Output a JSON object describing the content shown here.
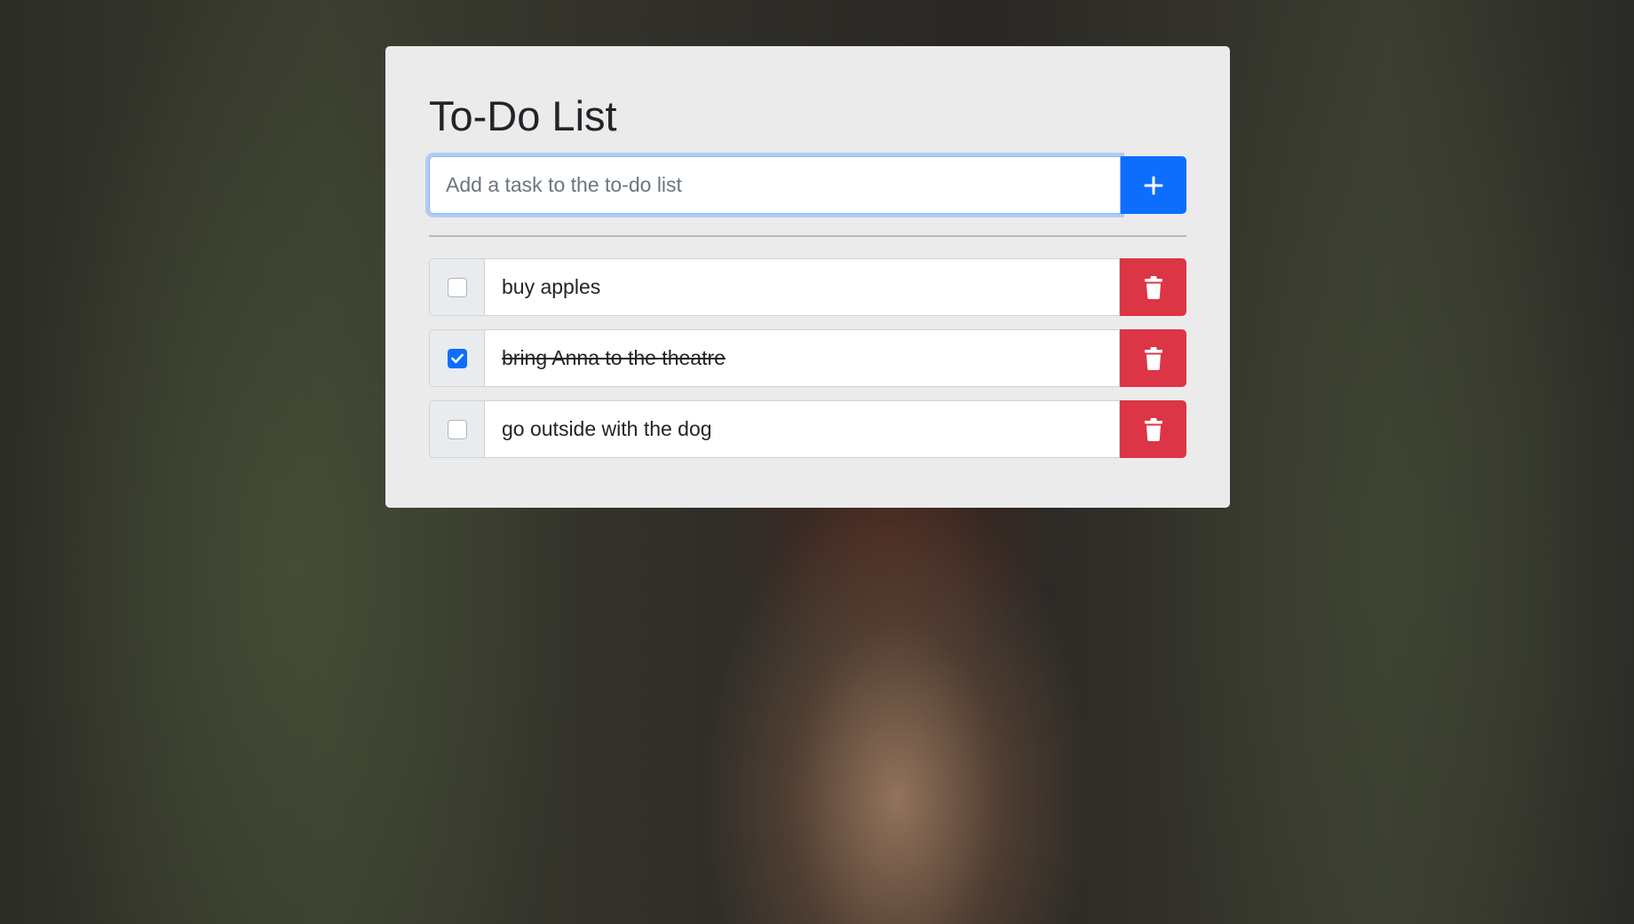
{
  "app": {
    "title": "To-Do List"
  },
  "add_task": {
    "placeholder": "Add a task to the to-do list",
    "value": "",
    "button_icon": "plus-icon"
  },
  "tasks": [
    {
      "label": "buy apples",
      "completed": false,
      "delete_icon": "trash-icon"
    },
    {
      "label": "bring Anna to the theatre",
      "completed": true,
      "delete_icon": "trash-icon"
    },
    {
      "label": "go outside with the dog",
      "completed": false,
      "delete_icon": "trash-icon"
    }
  ],
  "colors": {
    "primary": "#0d6efd",
    "danger": "#dc3545",
    "card_background": "#ebebeb"
  }
}
